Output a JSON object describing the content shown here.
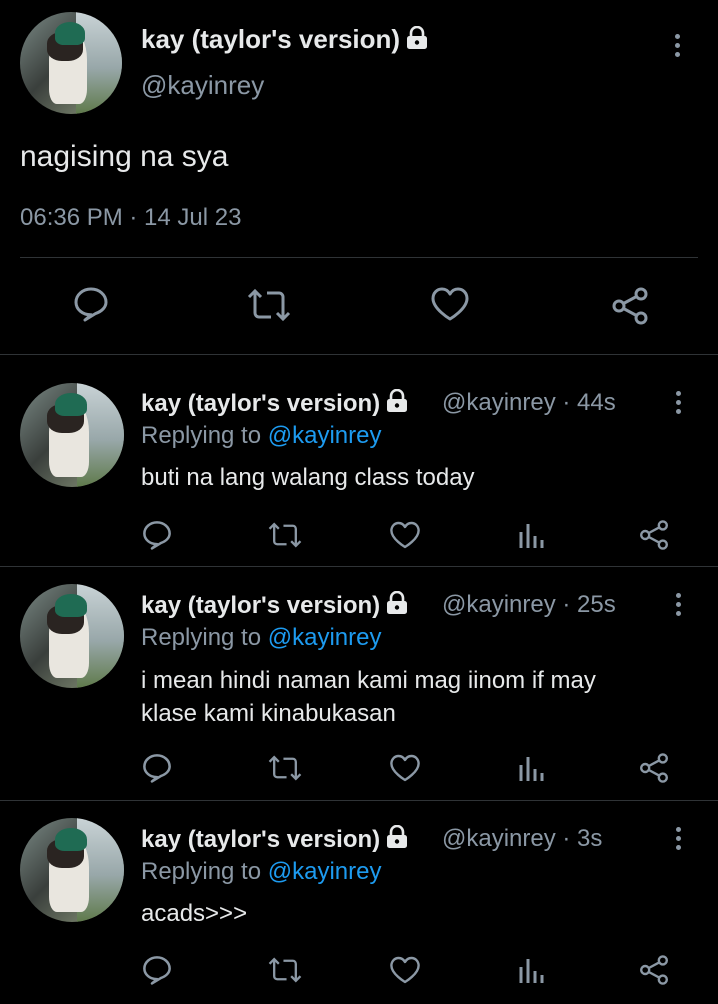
{
  "main_tweet": {
    "display_name": "kay (taylor's version)",
    "handle": "@kayinrey",
    "text": "nagising na sya",
    "timestamp": "06:36 PM · 14 Jul 23",
    "actions": [
      "reply-icon",
      "retweet-icon",
      "like-icon",
      "share-icon"
    ]
  },
  "replies": [
    {
      "display_name": "kay (taylor's version)",
      "handle_time": "@kayinrey · 44s",
      "replying_prefix": "Replying to ",
      "replying_to": "@kayinrey",
      "text_lines": [
        "buti na lang walang class today"
      ]
    },
    {
      "display_name": "kay (taylor's version)",
      "handle_time": "@kayinrey · 25s",
      "replying_prefix": "Replying to ",
      "replying_to": "@kayinrey",
      "text_lines": [
        "i mean hindi naman kami mag iinom if may",
        "klase kami kinabukasan"
      ]
    },
    {
      "display_name": "kay (taylor's version)",
      "handle_time": "@kayinrey · 3s",
      "replying_prefix": "Replying to ",
      "replying_to": "@kayinrey",
      "text_lines": [
        "acads>>>"
      ]
    }
  ],
  "colors": {
    "background": "#000000",
    "text": "#e7e9ea",
    "secondary": "#8b98a5",
    "mention": "#1d9bf0",
    "divider": "#2f3336"
  }
}
